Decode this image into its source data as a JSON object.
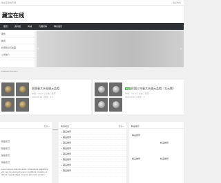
{
  "topbar": {
    "left_text": "欢迎来到钱币网",
    "right_text": "| 联系方式"
  },
  "header": {
    "logo": "藏宝在线"
  },
  "nav": {
    "items": [
      "首页",
      "资料馆",
      "商城",
      "代理详情",
      "联系我们"
    ]
  },
  "sidemenu": {
    "items": [
      "服务",
      "新闻",
      "钱币知识与鉴藏",
      "公司简介"
    ]
  },
  "banner": {
    "prev": "‹",
    "next": "›"
  },
  "section": {
    "label": "Products Premium"
  },
  "panels": [
    {
      "badge": "",
      "title": "民国袁大头现银元品相",
      "meta1": "作者：admin  |  分类：钱币",
      "meta2": "2023-06-01  |  浏览：12"
    },
    {
      "badge": "新品",
      "title": "民国三年袁大头银元品相（大元版）",
      "meta1": "作者：admin  |  分类：钱币",
      "meta2": "2023-06-01  |  浏览：8"
    }
  ],
  "columns": {
    "col1": {
      "more": "更多 »",
      "lines": [
        "藏品鉴赏",
        "藏品鉴赏",
        "藏品鉴赏",
        "藏品鉴赏"
      ],
      "para": "Lorem ipsum dolor sit amet, consectetur adipiscing elit, sed do eiusmod tempor incididunt ut labore et dolore magna aliqua. Ut enim ad minim veniam."
    },
    "col2": {
      "title": "新闻动态",
      "more": "更多 »",
      "items": [
        "藏品推荐",
        "藏品推荐",
        "藏品推荐",
        "藏品推荐",
        "藏品推荐",
        "藏品推荐",
        "藏品推荐",
        "藏品推荐"
      ]
    },
    "col3": {
      "title": "精品展示",
      "items": [
        "精品推荐",
        "精品推荐",
        "精品推荐",
        "精品推荐"
      ]
    }
  }
}
